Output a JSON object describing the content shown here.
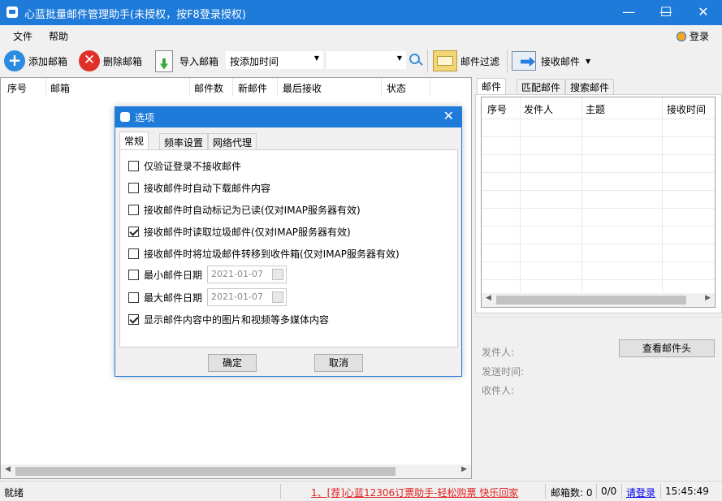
{
  "window": {
    "title": "心蓝批量邮件管理助手(未授权，按F8登录授权)"
  },
  "menu": {
    "file": "文件",
    "help": "帮助",
    "login": "登录"
  },
  "toolbar": {
    "add_mailbox": "添加邮箱",
    "delete_mailbox": "删除邮箱",
    "import_mailbox": "导入邮箱",
    "sort_select": "按添加时间",
    "mail_filter": "邮件过滤",
    "receive_mail": "接收邮件"
  },
  "mailbox_table": {
    "columns": [
      "序号",
      "邮箱",
      "邮件数",
      "新邮件",
      "最后接收",
      "状态"
    ]
  },
  "right_tabs": [
    "邮件",
    "匹配邮件",
    "搜索邮件"
  ],
  "mail_table": {
    "columns": [
      "序号",
      "发件人",
      "主题",
      "接收时间"
    ]
  },
  "detail": {
    "view_header_button": "查看邮件头",
    "sender_label": "发件人:",
    "sent_time_label": "发送时间:",
    "recipient_label": "收件人:"
  },
  "statusbar": {
    "status": "就绪",
    "promo": "1、[荐]心蓝12306订票助手-轻松购票 快乐回家",
    "mailbox_count": "邮箱数: 0",
    "ratio": "0/0",
    "login_link": "请登录",
    "time": "15:45:49"
  },
  "dialog": {
    "title": "选项",
    "tabs": [
      "常规",
      "频率设置",
      "网络代理"
    ],
    "options": [
      {
        "label": "仅验证登录不接收邮件",
        "checked": false
      },
      {
        "label": "接收邮件时自动下载邮件内容",
        "checked": false
      },
      {
        "label": "接收邮件时自动标记为已读(仅对IMAP服务器有效)",
        "checked": false
      },
      {
        "label": "接收邮件时读取垃圾邮件(仅对IMAP服务器有效)",
        "checked": true
      },
      {
        "label": "接收邮件时将垃圾邮件转移到收件箱(仅对IMAP服务器有效)",
        "checked": false
      },
      {
        "label": "最小邮件日期",
        "checked": false,
        "date": "2021-01-07"
      },
      {
        "label": "最大邮件日期",
        "checked": false,
        "date": "2021-01-07"
      },
      {
        "label": "显示邮件内容中的图片和视频等多媒体内容",
        "checked": true
      }
    ],
    "ok": "确定",
    "cancel": "取消"
  },
  "colors": {
    "accent": "#1e7bd9",
    "promo_link": "#e02020",
    "login_link": "#0000ee"
  }
}
